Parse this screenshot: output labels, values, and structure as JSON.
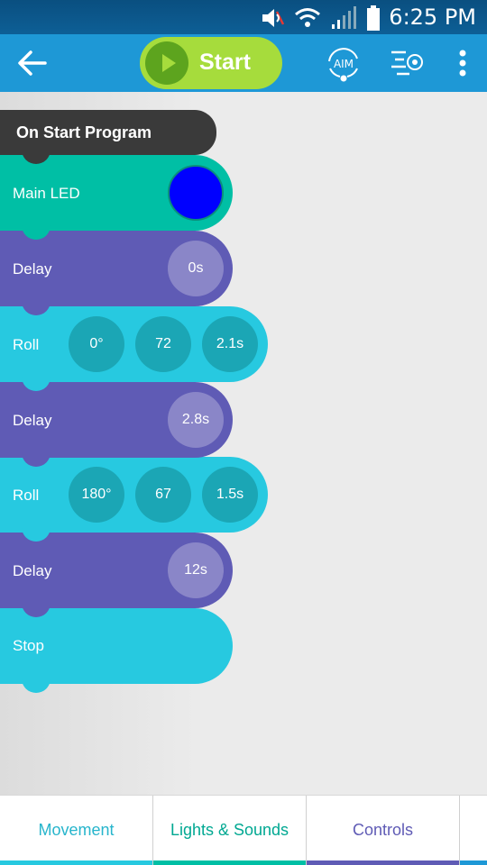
{
  "status_bar": {
    "time": "6:25 PM",
    "icons": [
      "mute-icon",
      "wifi-icon",
      "signal-icon",
      "battery-icon"
    ]
  },
  "app_bar": {
    "start_label": "Start",
    "aim_label": "AIM",
    "icons": [
      "back-arrow-icon",
      "play-icon",
      "aim-icon",
      "drive-icon",
      "more-vert-icon"
    ]
  },
  "program": {
    "header": "On Start Program",
    "blocks": [
      {
        "type": "Main LED",
        "color": "#0000ff"
      },
      {
        "type": "Delay",
        "duration": "0s"
      },
      {
        "type": "Roll",
        "heading": "0°",
        "speed": "72",
        "duration": "2.1s"
      },
      {
        "type": "Delay",
        "duration": "2.8s"
      },
      {
        "type": "Roll",
        "heading": "180°",
        "speed": "67",
        "duration": "1.5s"
      },
      {
        "type": "Delay",
        "duration": "12s"
      },
      {
        "type": "Stop"
      }
    ]
  },
  "tabs": [
    {
      "label": "Movement",
      "color": "#27c9e0"
    },
    {
      "label": "Lights & Sounds",
      "color": "#00bfa5"
    },
    {
      "label": "Controls",
      "color": "#5f5bb5"
    },
    {
      "label": "",
      "color": "#1e98d6"
    }
  ],
  "colors": {
    "app_bar": "#1e98d6",
    "start_button": "#a6dc3c",
    "roll": "#27c9e0",
    "delay": "#5f5bb5",
    "led": "#00bfa5"
  }
}
